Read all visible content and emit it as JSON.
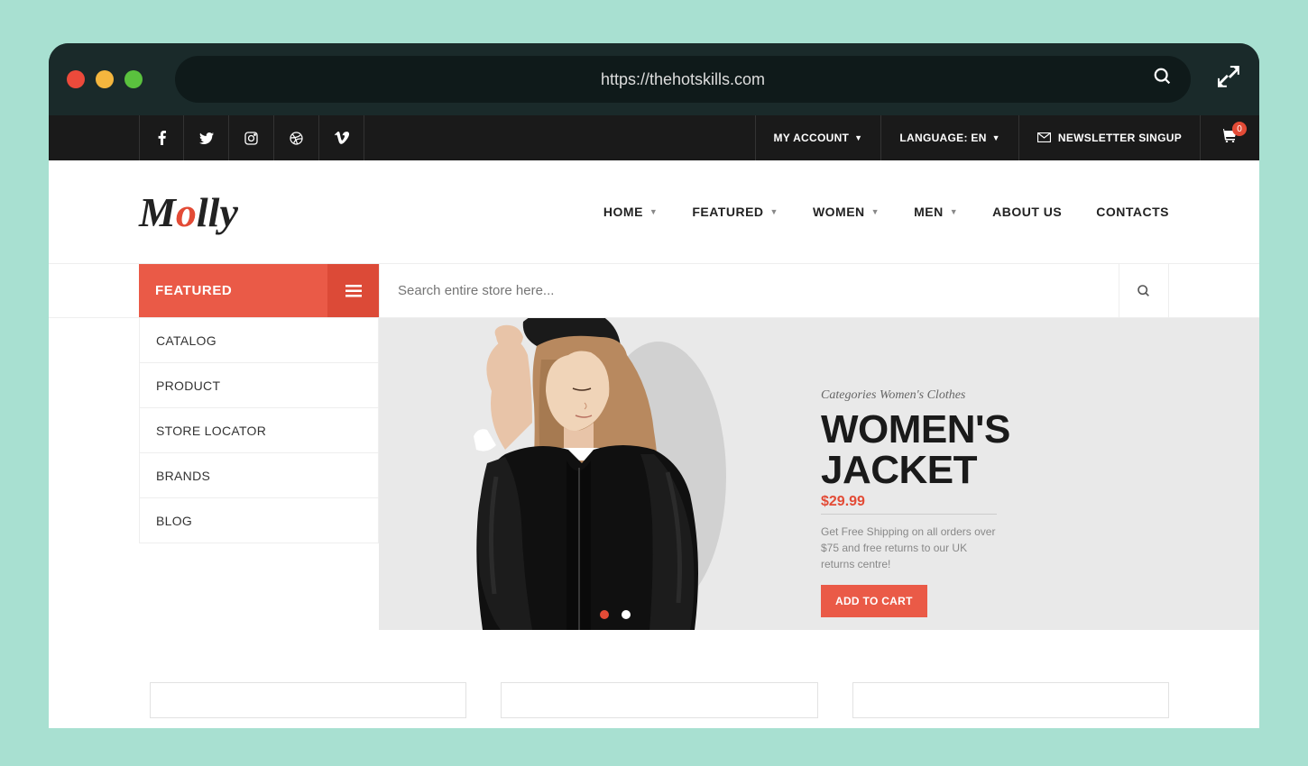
{
  "browser": {
    "url": "https://thehotskills.com"
  },
  "topbar": {
    "account": "MY ACCOUNT",
    "language": "LANGUAGE: EN",
    "newsletter": "NEWSLETTER SINGUP",
    "cartCount": "0"
  },
  "logo": {
    "part1": "M",
    "accent": "o",
    "part2": "lly"
  },
  "nav": [
    {
      "label": "HOME",
      "dropdown": true
    },
    {
      "label": "FEATURED",
      "dropdown": true
    },
    {
      "label": "WOMEN",
      "dropdown": true
    },
    {
      "label": "MEN",
      "dropdown": true
    },
    {
      "label": "ABOUT US",
      "dropdown": false
    },
    {
      "label": "CONTACTS",
      "dropdown": false
    }
  ],
  "sidebar": {
    "featured": "FEATURED",
    "items": [
      "CATALOG",
      "PRODUCT",
      "STORE LOCATOR",
      "BRANDS",
      "BLOG"
    ]
  },
  "search": {
    "placeholder": "Search entire store here..."
  },
  "hero": {
    "category": "Categories Women's Clothes",
    "titleLine1": "WOMEN'S",
    "titleLine2": "JACKET",
    "price": "$29.99",
    "desc": "Get Free Shipping on all orders over $75 and free returns to our UK returns centre!",
    "cta": "ADD TO CART"
  }
}
